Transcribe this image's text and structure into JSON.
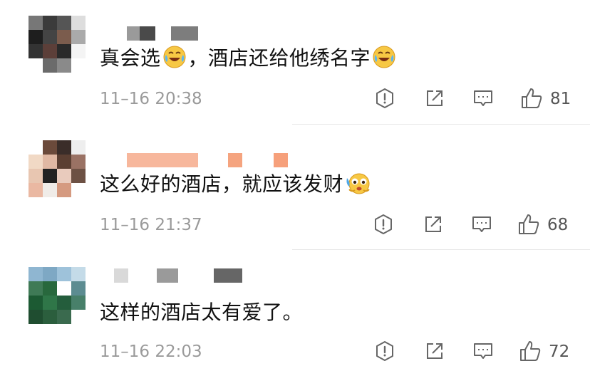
{
  "comments": [
    {
      "text_a": "真会选",
      "text_b": "，酒店还给他绣名字",
      "time": "11–16 20:38",
      "likes": "81"
    },
    {
      "text_a": "这么好的酒店，就应该发财",
      "time": "11–16 21:37",
      "likes": "68"
    },
    {
      "text_a": "这样的酒店太有爱了。",
      "time": "11–16 22:03",
      "likes": "72"
    }
  ],
  "icons": {
    "report": "alert-circle-icon",
    "share": "external-share-icon",
    "reply": "message-icon",
    "like": "thumbs-up-icon"
  }
}
